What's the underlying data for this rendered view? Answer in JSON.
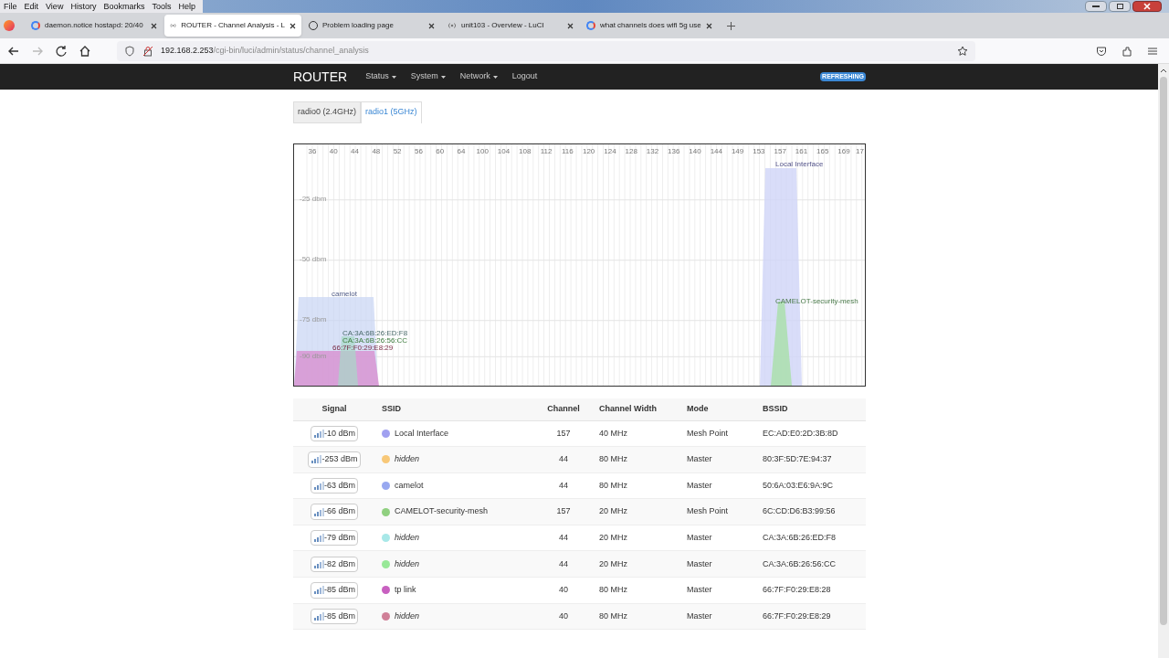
{
  "menu_bar": [
    "File",
    "Edit",
    "View",
    "History",
    "Bookmarks",
    "Tools",
    "Help"
  ],
  "tabs": [
    {
      "title": "daemon.notice hostapd: 20/40",
      "kind": "search",
      "selected": false
    },
    {
      "title": "ROUTER - Channel Analysis - L",
      "kind": "router",
      "selected": true
    },
    {
      "title": "Problem loading page",
      "kind": "error",
      "selected": false
    },
    {
      "title": "unit103 - Overview - LuCI",
      "kind": "router",
      "selected": false
    },
    {
      "title": "what channels does wifi 5g use",
      "kind": "search",
      "selected": false
    }
  ],
  "address_bar": {
    "host": "192.168.2.253",
    "path": "/cgi-bin/luci/admin/status/channel_analysis"
  },
  "header": {
    "brand": "ROUTER",
    "menu": [
      {
        "label": "Status",
        "dropdown": true
      },
      {
        "label": "System",
        "dropdown": true
      },
      {
        "label": "Network",
        "dropdown": true
      },
      {
        "label": "Logout",
        "dropdown": false
      }
    ],
    "badge": "REFRESHING"
  },
  "radio_tabs": [
    {
      "label": "radio0 (2.4GHz)",
      "selected": false
    },
    {
      "label": "radio1 (5GHz)",
      "selected": true
    }
  ],
  "chart": {
    "channel_labels": [
      "36",
      "40",
      "44",
      "48",
      "52",
      "56",
      "60",
      "64",
      "100",
      "104",
      "108",
      "112",
      "116",
      "120",
      "124",
      "128",
      "132",
      "136",
      "140",
      "144",
      "149",
      "153",
      "157",
      "161",
      "165",
      "169",
      "17"
    ],
    "level_labels": [
      "-25 dbm",
      "-50 dbm",
      "-75 dbm",
      "-90 dbm"
    ],
    "network_labels": [
      "Local Interface",
      "CAMELOT-security-mesh",
      "camelot",
      "CA:3A:6B:26:ED:F8",
      "CA:3A:6B:26:56:CC",
      "66:7F:F0:29:E8:29"
    ]
  },
  "table": {
    "columns": [
      "Signal",
      "SSID",
      "Channel",
      "Channel Width",
      "Mode",
      "BSSID"
    ],
    "rows": [
      {
        "signal": "-10 dBm",
        "ssid": "Local Interface",
        "hidden": false,
        "color": "#a0a0f0",
        "channel": "157",
        "width": "40 MHz",
        "mode": "Mesh Point",
        "bssid": "EC:AD:E0:2D:3B:8D"
      },
      {
        "signal": "-253 dBm",
        "ssid": "hidden",
        "hidden": true,
        "color": "#f8c878",
        "channel": "44",
        "width": "80 MHz",
        "mode": "Master",
        "bssid": "80:3F:5D:7E:94:37"
      },
      {
        "signal": "-63 dBm",
        "ssid": "camelot",
        "hidden": false,
        "color": "#98a8f0",
        "channel": "44",
        "width": "80 MHz",
        "mode": "Master",
        "bssid": "50:6A:03:E6:9A:9C"
      },
      {
        "signal": "-66 dBm",
        "ssid": "CAMELOT-security-mesh",
        "hidden": false,
        "color": "#90d080",
        "channel": "157",
        "width": "20 MHz",
        "mode": "Mesh Point",
        "bssid": "6C:CD:D6:B3:99:56"
      },
      {
        "signal": "-79 dBm",
        "ssid": "hidden",
        "hidden": true,
        "color": "#a8e8e8",
        "channel": "44",
        "width": "20 MHz",
        "mode": "Master",
        "bssid": "CA:3A:6B:26:ED:F8"
      },
      {
        "signal": "-82 dBm",
        "ssid": "hidden",
        "hidden": true,
        "color": "#98e898",
        "channel": "44",
        "width": "20 MHz",
        "mode": "Master",
        "bssid": "CA:3A:6B:26:56:CC"
      },
      {
        "signal": "-85 dBm",
        "ssid": "tp link",
        "hidden": false,
        "color": "#c860c0",
        "channel": "40",
        "width": "80 MHz",
        "mode": "Master",
        "bssid": "66:7F:F0:29:E8:28"
      },
      {
        "signal": "-85 dBm",
        "ssid": "hidden",
        "hidden": true,
        "color": "#d08098",
        "channel": "40",
        "width": "80 MHz",
        "mode": "Master",
        "bssid": "66:7F:F0:29:E8:29"
      }
    ]
  }
}
